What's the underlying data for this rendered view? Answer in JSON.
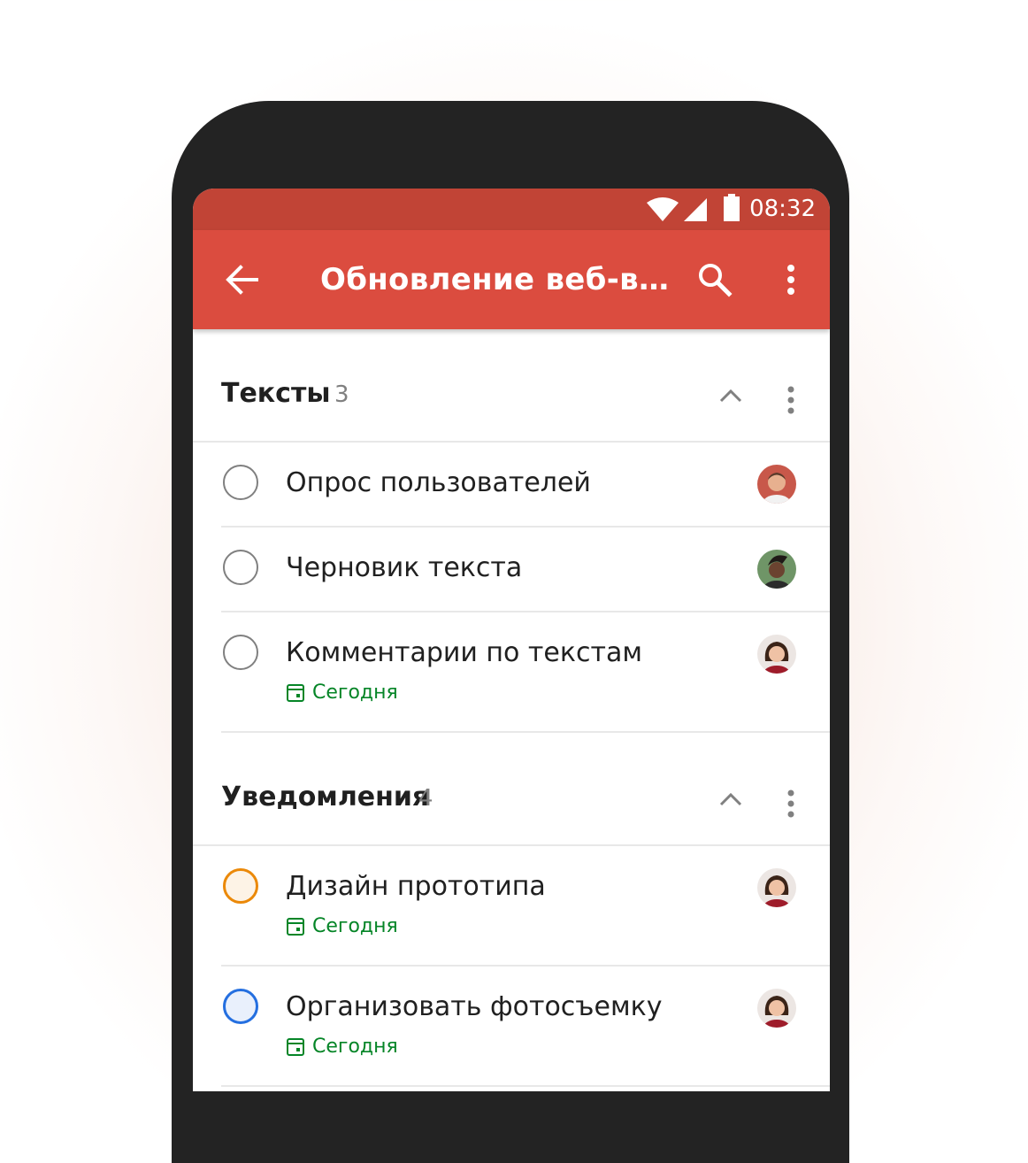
{
  "status_bar": {
    "time": "08:32"
  },
  "app_bar": {
    "title": "Обновление веб-ве..."
  },
  "colors": {
    "app_bar": "#db4c3f",
    "status_bar": "#c14436",
    "due_today": "#058527",
    "priority_orange": "#eb8909",
    "priority_blue": "#246fe0"
  },
  "icons": {
    "back": "arrow-back-icon",
    "search": "search-icon",
    "menu": "more-vert-icon",
    "collapse": "chevron-up-icon",
    "due": "calendar-icon"
  },
  "sections": [
    {
      "name": "Тексты",
      "count": "3",
      "tasks": [
        {
          "title": "Опрос пользователей",
          "due": ""
        },
        {
          "title": "Черновик текста",
          "due": ""
        },
        {
          "title": "Комментарии по текстам",
          "due": "Сегодня"
        }
      ]
    },
    {
      "name": "Уведомления",
      "count": "4",
      "tasks": [
        {
          "title": "Дизайн прототипа",
          "due": "Сегодня",
          "priority": "orange"
        },
        {
          "title": "Организовать фотосъемку",
          "due": "Сегодня",
          "priority": "blue"
        }
      ]
    }
  ]
}
